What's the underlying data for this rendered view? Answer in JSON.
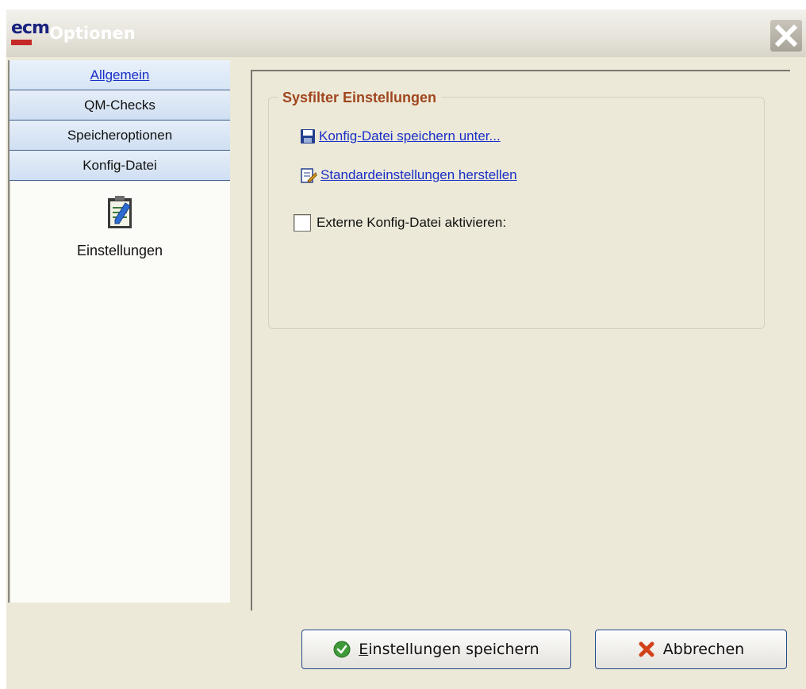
{
  "window": {
    "title": "Optionen",
    "logo_text": "ecm"
  },
  "sidebar": {
    "items": [
      {
        "label": "Allgemein",
        "active": true
      },
      {
        "label": "QM-Checks",
        "active": false
      },
      {
        "label": "Speicheroptionen",
        "active": false
      },
      {
        "label": "Konfig-Datei",
        "active": false
      }
    ],
    "tile_label": "Einstellungen"
  },
  "main": {
    "group_title": "Sysfilter Einstellungen",
    "links": [
      {
        "label": "Konfig-Datei speichern unter...",
        "icon": "floppy-disk-icon"
      },
      {
        "label": "Standardeinstellungen herstellen",
        "icon": "restore-defaults-icon"
      }
    ],
    "checkbox_label": "Externe Konfig-Datei aktivieren:",
    "checkbox_checked": false
  },
  "buttons": {
    "save_mnemonic": "E",
    "save_rest": "instellungen speichern",
    "cancel_label": "Abbrechen"
  },
  "colors": {
    "nav_background": "#d6e5f5",
    "link": "#1a2fc8",
    "group_title": "#a0461e"
  }
}
